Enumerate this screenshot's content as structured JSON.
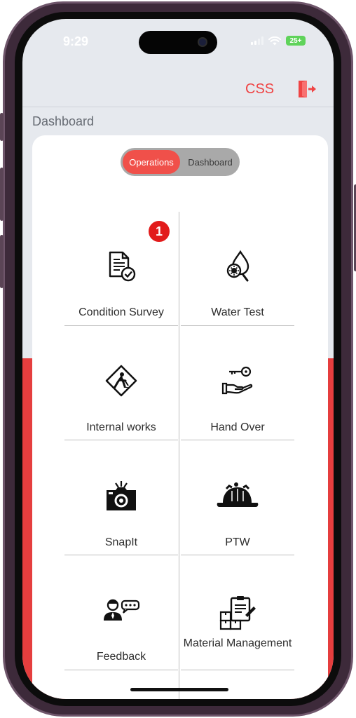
{
  "status_bar": {
    "time": "9:29",
    "battery": "25+"
  },
  "header": {
    "org_label": "CSS",
    "logout_icon": "logout-door-icon"
  },
  "page": {
    "title": "Dashboard"
  },
  "toggle": {
    "active": "Operations",
    "inactive": "Dashboard"
  },
  "tiles": [
    {
      "label": "Condition Survey",
      "icon": "checked-document-icon",
      "badge": "1"
    },
    {
      "label": "Water Test",
      "icon": "water-drop-magnifier-icon"
    },
    {
      "label": "Internal works",
      "icon": "work-sign-icon"
    },
    {
      "label": "Hand Over",
      "icon": "key-hand-icon"
    },
    {
      "label": "SnapIt",
      "icon": "camera-icon"
    },
    {
      "label": "PTW",
      "icon": "hard-hat-icon"
    },
    {
      "label": "Feedback",
      "icon": "person-chat-icon"
    },
    {
      "label": "Material Management",
      "icon": "clipboard-boxes-icon"
    }
  ],
  "colors": {
    "accent": "#ef4444",
    "band": "#e53e3e",
    "toggle_active": "#f0504a",
    "badge": "#e21b1b"
  }
}
